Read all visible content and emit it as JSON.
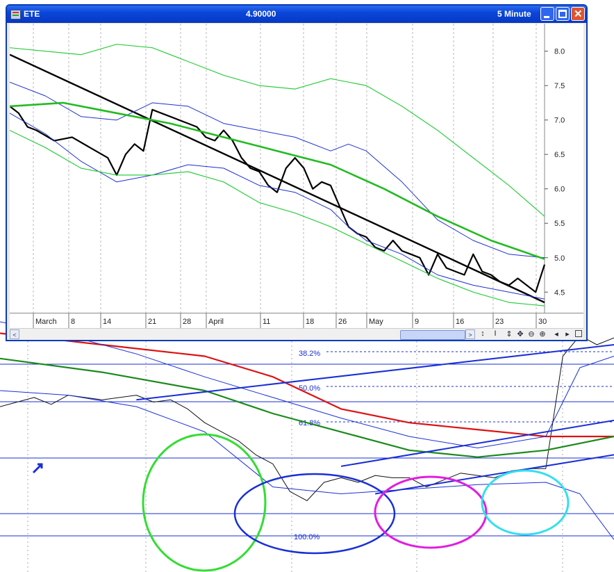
{
  "window": {
    "symbol": "ETE",
    "price": "4.90000",
    "interval": "5 Minute"
  },
  "colors": {
    "price": "#000000",
    "trendline": "#000000",
    "bollinger": "#1f2fd0",
    "envelope": "#2ecc40",
    "moving_average": "#22bb22",
    "red_ma": "#dd1111",
    "green_ma": "#1a8a1a",
    "circle_green": "#33dd33",
    "circle_blue": "#1a2fd6",
    "circle_magenta": "#e01ee0",
    "circle_cyan": "#33dfee"
  },
  "chart_data": [
    {
      "type": "line",
      "title": "ETE",
      "x_tick_labels": [
        "March",
        "8",
        "14",
        "21",
        "28",
        "April",
        "11",
        "18",
        "26",
        "May",
        "9",
        "16",
        "23",
        "30"
      ],
      "y_tick_labels": [
        "8.0",
        "7.5",
        "7.0",
        "6.5",
        "6.0",
        "5.5",
        "5.0",
        "4.5"
      ],
      "ylim": [
        4.2,
        8.4
      ],
      "grid": true,
      "series": [
        {
          "key": "price",
          "points": [
            [
              0,
              7.2
            ],
            [
              1,
              7.1
            ],
            [
              2,
              6.9
            ],
            [
              3,
              6.85
            ],
            [
              5,
              6.7
            ],
            [
              7,
              6.75
            ],
            [
              9,
              6.6
            ],
            [
              11,
              6.45
            ],
            [
              12,
              6.2
            ],
            [
              13,
              6.5
            ],
            [
              14,
              6.65
            ],
            [
              15,
              6.55
            ],
            [
              16,
              7.15
            ],
            [
              17,
              7.1
            ],
            [
              18,
              7.05
            ],
            [
              19,
              7.0
            ],
            [
              20,
              6.95
            ],
            [
              21,
              6.9
            ],
            [
              22,
              6.75
            ],
            [
              23,
              6.7
            ],
            [
              24,
              6.85
            ],
            [
              25,
              6.7
            ],
            [
              26,
              6.45
            ],
            [
              27,
              6.3
            ],
            [
              28,
              6.25
            ],
            [
              29,
              6.05
            ],
            [
              30,
              5.95
            ],
            [
              31,
              6.3
            ],
            [
              32,
              6.45
            ],
            [
              33,
              6.3
            ],
            [
              34,
              6.0
            ],
            [
              35,
              6.1
            ],
            [
              36,
              6.05
            ],
            [
              37,
              5.75
            ],
            [
              38,
              5.45
            ],
            [
              39,
              5.35
            ],
            [
              40,
              5.3
            ],
            [
              41,
              5.15
            ],
            [
              42,
              5.1
            ],
            [
              43,
              5.25
            ],
            [
              44,
              5.1
            ],
            [
              45,
              5.05
            ],
            [
              46,
              5.0
            ],
            [
              47,
              4.75
            ],
            [
              48,
              5.05
            ],
            [
              49,
              4.85
            ],
            [
              50,
              4.8
            ],
            [
              51,
              4.75
            ],
            [
              52,
              5.05
            ],
            [
              53,
              4.8
            ],
            [
              54,
              4.75
            ],
            [
              55,
              4.65
            ],
            [
              56,
              4.6
            ],
            [
              57,
              4.7
            ],
            [
              58,
              4.6
            ],
            [
              59,
              4.5
            ],
            [
              60,
              4.9
            ]
          ]
        },
        {
          "key": "trendline",
          "points": [
            [
              0,
              7.95
            ],
            [
              60,
              4.35
            ]
          ]
        },
        {
          "key": "bollinger_upper",
          "points": [
            [
              0,
              7.55
            ],
            [
              4,
              7.35
            ],
            [
              8,
              7.05
            ],
            [
              12,
              7.0
            ],
            [
              16,
              7.25
            ],
            [
              20,
              7.2
            ],
            [
              24,
              6.95
            ],
            [
              28,
              6.85
            ],
            [
              32,
              6.75
            ],
            [
              36,
              6.55
            ],
            [
              38,
              6.65
            ],
            [
              40,
              6.55
            ],
            [
              44,
              6.1
            ],
            [
              48,
              5.55
            ],
            [
              52,
              5.25
            ],
            [
              56,
              5.05
            ],
            [
              60,
              5.0
            ]
          ]
        },
        {
          "key": "bollinger_lower",
          "points": [
            [
              0,
              7.1
            ],
            [
              4,
              6.8
            ],
            [
              8,
              6.4
            ],
            [
              12,
              6.1
            ],
            [
              16,
              6.2
            ],
            [
              20,
              6.35
            ],
            [
              24,
              6.3
            ],
            [
              28,
              6.05
            ],
            [
              32,
              5.95
            ],
            [
              36,
              5.7
            ],
            [
              38,
              5.45
            ],
            [
              40,
              5.25
            ],
            [
              44,
              5.05
            ],
            [
              48,
              4.75
            ],
            [
              52,
              4.6
            ],
            [
              56,
              4.5
            ],
            [
              60,
              4.4
            ]
          ]
        },
        {
          "key": "envelope_upper",
          "points": [
            [
              0,
              8.05
            ],
            [
              8,
              7.95
            ],
            [
              12,
              8.1
            ],
            [
              16,
              8.05
            ],
            [
              20,
              7.85
            ],
            [
              24,
              7.65
            ],
            [
              28,
              7.5
            ],
            [
              32,
              7.45
            ],
            [
              36,
              7.6
            ],
            [
              40,
              7.5
            ],
            [
              44,
              7.2
            ],
            [
              48,
              6.85
            ],
            [
              52,
              6.45
            ],
            [
              56,
              6.05
            ],
            [
              60,
              5.6
            ]
          ]
        },
        {
          "key": "envelope_lower",
          "points": [
            [
              0,
              6.85
            ],
            [
              4,
              6.6
            ],
            [
              8,
              6.3
            ],
            [
              12,
              6.2
            ],
            [
              16,
              6.2
            ],
            [
              20,
              6.25
            ],
            [
              24,
              6.1
            ],
            [
              28,
              5.8
            ],
            [
              32,
              5.65
            ],
            [
              36,
              5.45
            ],
            [
              40,
              5.2
            ],
            [
              44,
              4.95
            ],
            [
              48,
              4.7
            ],
            [
              52,
              4.5
            ],
            [
              56,
              4.35
            ],
            [
              60,
              4.3
            ]
          ]
        },
        {
          "key": "moving_average",
          "points": [
            [
              0,
              7.2
            ],
            [
              6,
              7.25
            ],
            [
              12,
              7.1
            ],
            [
              18,
              6.95
            ],
            [
              24,
              6.75
            ],
            [
              30,
              6.55
            ],
            [
              36,
              6.35
            ],
            [
              42,
              6.0
            ],
            [
              48,
              5.6
            ],
            [
              54,
              5.25
            ],
            [
              60,
              4.98
            ]
          ]
        }
      ]
    },
    {
      "type": "line",
      "fib_labels": [
        "38.2%",
        "50.0%",
        "61.8%",
        "100.0%"
      ],
      "ylim": [
        0,
        1
      ],
      "series": [
        {
          "key": "price",
          "points": [
            [
              0,
              0.63
            ],
            [
              2,
              0.67
            ],
            [
              3,
              0.64
            ],
            [
              4,
              0.68
            ],
            [
              6,
              0.66
            ],
            [
              8,
              0.68
            ],
            [
              9,
              0.65
            ],
            [
              10,
              0.66
            ],
            [
              11,
              0.62
            ],
            [
              12,
              0.56
            ],
            [
              13,
              0.52
            ],
            [
              14,
              0.48
            ],
            [
              15,
              0.42
            ],
            [
              16,
              0.38
            ],
            [
              17,
              0.26
            ],
            [
              18,
              0.22
            ],
            [
              19,
              0.3
            ],
            [
              20,
              0.32
            ],
            [
              21,
              0.3
            ],
            [
              22,
              0.33
            ],
            [
              23,
              0.32
            ],
            [
              24,
              0.32
            ],
            [
              25,
              0.28
            ],
            [
              26,
              0.31
            ],
            [
              27,
              0.34
            ],
            [
              28,
              0.33
            ],
            [
              29,
              0.32
            ],
            [
              30,
              0.35
            ],
            [
              31,
              0.36
            ],
            [
              32,
              0.36
            ],
            [
              33,
              0.85
            ],
            [
              34,
              0.94
            ],
            [
              35,
              0.9
            ],
            [
              36,
              0.93
            ]
          ]
        },
        {
          "key": "red_ma",
          "points": [
            [
              0,
              0.95
            ],
            [
              6,
              0.9
            ],
            [
              12,
              0.85
            ],
            [
              16,
              0.76
            ],
            [
              20,
              0.62
            ],
            [
              24,
              0.56
            ],
            [
              28,
              0.53
            ],
            [
              32,
              0.5
            ],
            [
              36,
              0.5
            ]
          ]
        },
        {
          "key": "green_ma",
          "points": [
            [
              0,
              0.84
            ],
            [
              6,
              0.78
            ],
            [
              12,
              0.7
            ],
            [
              16,
              0.6
            ],
            [
              20,
              0.52
            ],
            [
              24,
              0.44
            ],
            [
              28,
              0.41
            ],
            [
              32,
              0.44
            ],
            [
              36,
              0.5
            ]
          ]
        },
        {
          "key": "band_upper",
          "points": [
            [
              0,
              1.0
            ],
            [
              4,
              0.94
            ],
            [
              8,
              0.86
            ],
            [
              12,
              0.76
            ],
            [
              16,
              0.67
            ],
            [
              20,
              0.58
            ],
            [
              24,
              0.5
            ],
            [
              28,
              0.45
            ],
            [
              32,
              0.5
            ],
            [
              34,
              0.8
            ],
            [
              36,
              0.85
            ]
          ]
        },
        {
          "key": "band_lower",
          "points": [
            [
              0,
              0.7
            ],
            [
              4,
              0.68
            ],
            [
              8,
              0.63
            ],
            [
              12,
              0.52
            ],
            [
              16,
              0.28
            ],
            [
              20,
              0.25
            ],
            [
              24,
              0.27
            ],
            [
              28,
              0.29
            ],
            [
              32,
              0.3
            ],
            [
              34,
              0.25
            ],
            [
              36,
              0.05
            ]
          ]
        },
        {
          "key": "trendline_top",
          "points": [
            [
              8,
              0.66
            ],
            [
              36,
              0.9
            ]
          ]
        },
        {
          "key": "trendline_mid",
          "points": [
            [
              20,
              0.37
            ],
            [
              36,
              0.57
            ]
          ]
        },
        {
          "key": "trendline_low",
          "points": [
            [
              22,
              0.25
            ],
            [
              36,
              0.42
            ]
          ]
        }
      ]
    }
  ]
}
